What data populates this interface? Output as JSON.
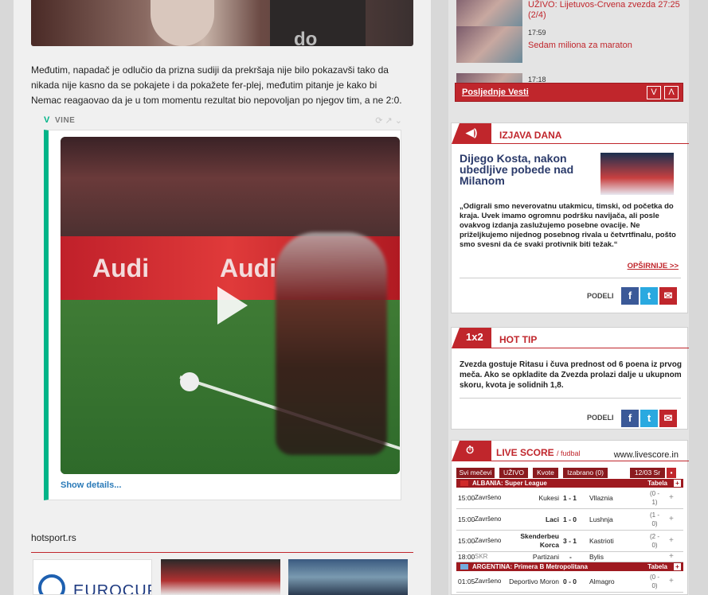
{
  "article": {
    "paragraph": "Međutim, napadač je odlučio da prizna sudiji da prekršaja nije bilo pokazavši tako da nikada nije kasno da se pokajete i da pokažete fer-plej, međutim pitanje je kako bi Nemac reagaovao da je u tom momentu rezultat bio nepovoljan po njegov tim, a ne 2:0.",
    "vine_label": "VINE",
    "show_details": "Show details...",
    "source": "hotsport.rs",
    "thumb1_text": "EUROCUP"
  },
  "sidebar": {
    "news": [
      {
        "time": "",
        "title": "UŽIVO: Lijetuvos-Crvena zvezda 27:25 (2/4)"
      },
      {
        "time": "17:59",
        "title": "Sedam miliona za maraton"
      },
      {
        "time": "17:18",
        "title": ""
      }
    ],
    "latest_label": "Posljednje Vesti",
    "nav_down": "V",
    "nav_up": "Λ"
  },
  "izjava": {
    "title": "IZJAVA DANA",
    "headline": "Dijego Kosta, nakon ubedljive pobede nad Milanom",
    "quote": "„Odigrali smo neverovatnu utakmicu, timski, od početka do kraja. Uvek imamo ogromnu podršku navijača, ali posle ovakvog izdanja zaslužujemo posebne ovacije. Ne priželjkujemo nijednog posebnog rivala u četvrtfinalu, pošto smo svesni da će svaki protivnik biti težak.“",
    "more": "OPŠIRNIJE >>",
    "share_label": "PODELI"
  },
  "hottip": {
    "icon": "1x2",
    "title": "HOT TIP",
    "text": "Zvezda gostuje Ritasu i čuva prednost od 6 poena iz prvog meča. Ako se opkladite da Zvezda prolazi dalje u ukupnom skoru, kvota je solidnih 1,8.",
    "share_label": "PODELI"
  },
  "livescore": {
    "title": "LIVE SCORE",
    "subtitle": "/ fudbal",
    "site": "www.livescore.in",
    "tabs": [
      "Svi mečevi",
      "UŽIVO",
      "Kvote",
      "Izabrano (0)",
      "12/03 Sr"
    ],
    "tabela": "Tabela",
    "leagues": [
      {
        "name": "ALBANIA: Super League",
        "matches": [
          {
            "time": "15:00",
            "status": "Završeno",
            "home": "Kukesi",
            "score": "1 - 1",
            "away": "Vllaznia",
            "extra": "(0 - 1)"
          },
          {
            "time": "15:00",
            "status": "Završeno",
            "home": "Laci",
            "score": "1 - 0",
            "away": "Lushnja",
            "extra": "(1 - 0)"
          },
          {
            "time": "15:00",
            "status": "Završeno",
            "home": "Skenderbeu Korca",
            "score": "3 - 1",
            "away": "Kastrioti",
            "extra": "(2 - 0)"
          },
          {
            "time": "18:00",
            "status": "SKR",
            "home": "Partizani",
            "score": "-",
            "away": "Bylis",
            "extra": ""
          }
        ]
      },
      {
        "name": "ARGENTINA: Primera B Metropolitana",
        "matches": [
          {
            "time": "01:05",
            "status": "Završeno",
            "home": "Deportivo Moron",
            "score": "0 - 0",
            "away": "Almagro",
            "extra": "(0 - 0)"
          }
        ]
      }
    ]
  }
}
